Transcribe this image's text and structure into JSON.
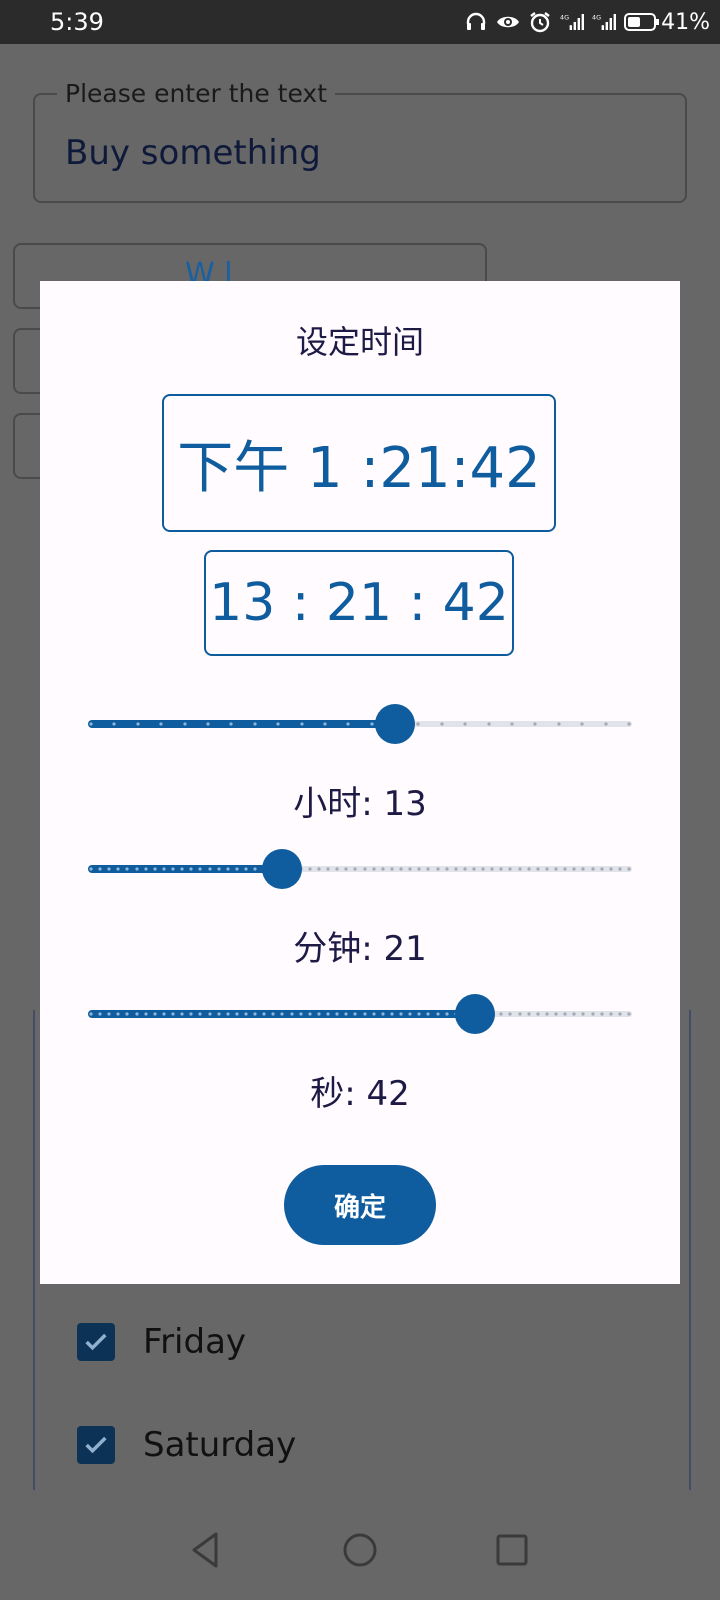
{
  "status_bar": {
    "time": "5:39",
    "battery": "41%",
    "icons": [
      "headphones-icon",
      "eye-icon",
      "alarm-icon",
      "signal-4g-icon",
      "signal-4g-icon",
      "battery-icon"
    ]
  },
  "background": {
    "text_field": {
      "label": "Please enter the text",
      "value": "Buy something"
    },
    "button_partial": "W  l",
    "days": [
      {
        "label": "Friday",
        "checked": true
      },
      {
        "label": "Saturday",
        "checked": true
      }
    ]
  },
  "dialog": {
    "title": "设定时间",
    "time_12h": "下午 1 :21:42",
    "time_24h": "13 : 21 : 42",
    "hour": {
      "label": "小时: 13",
      "value": 13,
      "max": 23
    },
    "minute": {
      "label": "分钟: 21",
      "value": 21,
      "max": 59
    },
    "second": {
      "label": "秒: 42",
      "value": 42,
      "max": 59
    },
    "confirm_label": "确定"
  },
  "colors": {
    "accent": "#0f5c9e",
    "scrim": "#676767",
    "dialog_bg": "#fffbfe",
    "text_dark": "#1d1a45"
  },
  "nav": {
    "icons": [
      "back-icon",
      "home-icon",
      "recents-icon"
    ]
  }
}
